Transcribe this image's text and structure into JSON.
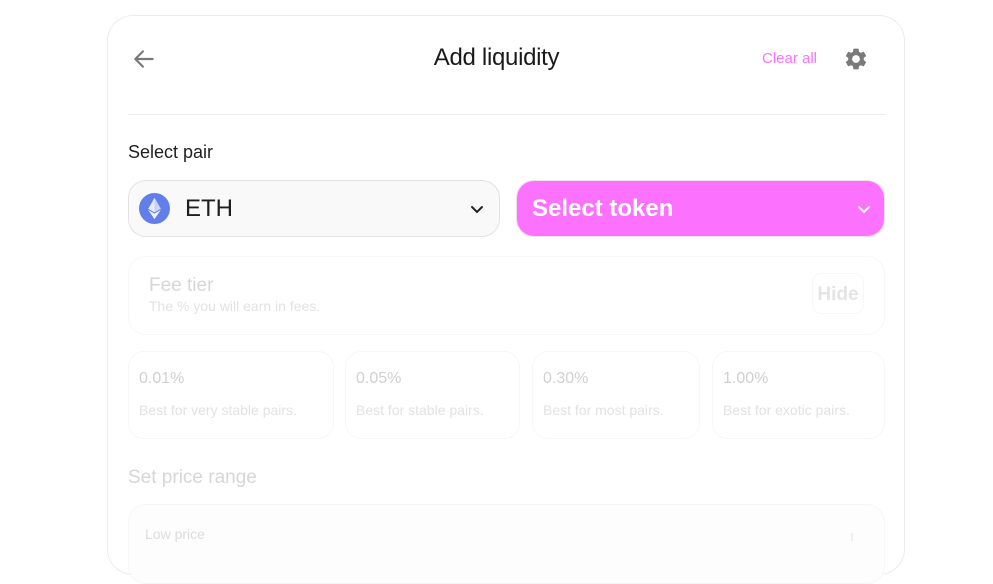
{
  "header": {
    "title": "Add liquidity",
    "clear_all_label": "Clear all",
    "back_icon": "arrow-left-icon",
    "settings_icon": "gear-icon"
  },
  "pair": {
    "label": "Select pair",
    "token_a": {
      "symbol": "ETH",
      "icon": "ethereum-icon"
    },
    "token_b": {
      "label": "Select token"
    }
  },
  "fee_tier": {
    "title": "Fee tier",
    "subtitle": "The % you will earn in fees.",
    "hide_label": "Hide",
    "options": [
      {
        "pct": "0.01%",
        "desc": "Best for very stable pairs."
      },
      {
        "pct": "0.05%",
        "desc": "Best for stable pairs."
      },
      {
        "pct": "0.30%",
        "desc": "Best for most pairs."
      },
      {
        "pct": "1.00%",
        "desc": "Best for exotic pairs."
      }
    ]
  },
  "price_range": {
    "label": "Set price range",
    "low_price_label": "Low price"
  },
  "colors": {
    "accent": "#fc72ff",
    "eth": "#627eea"
  }
}
